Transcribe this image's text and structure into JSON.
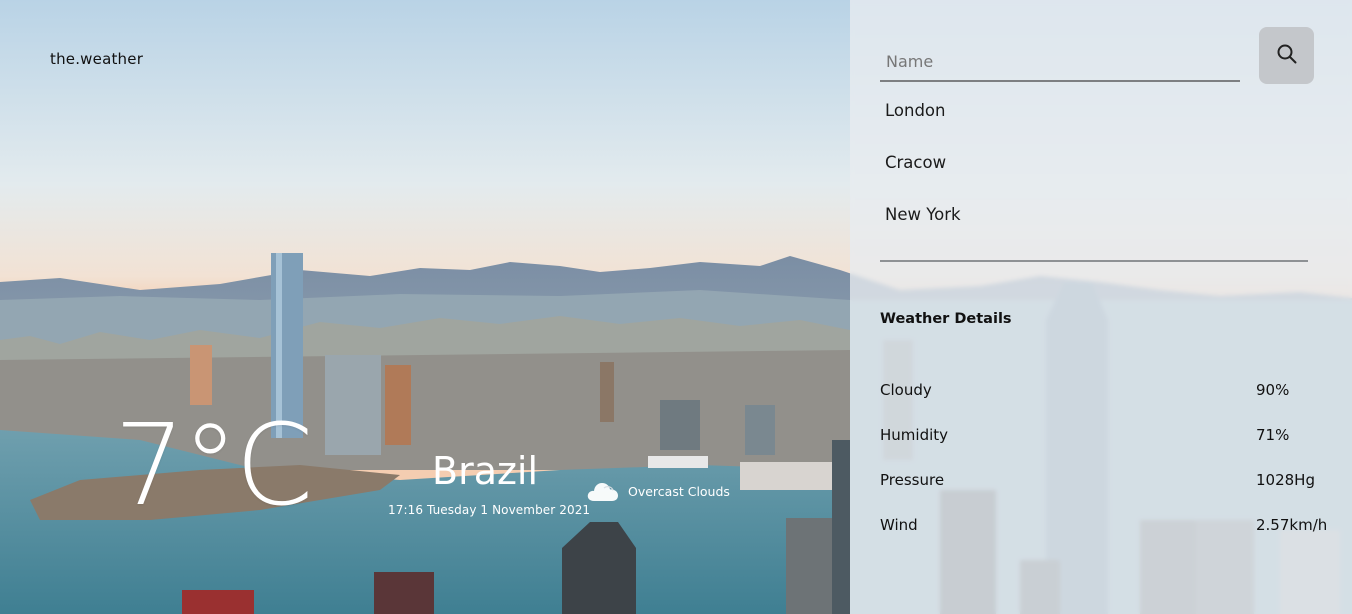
{
  "brand": "the.weather",
  "current": {
    "temperature": "7°C",
    "city": "Brazil",
    "datetime": "17:16 Tuesday 1 November 2021",
    "condition": "Overcast Clouds",
    "condition_icon": "cloud-icon"
  },
  "search": {
    "placeholder": "Name",
    "button_icon": "search-icon"
  },
  "cities": [
    "London",
    "Cracow",
    "New York"
  ],
  "details": {
    "title": "Weather Details",
    "rows": [
      {
        "label": "Cloudy",
        "value": "90%"
      },
      {
        "label": "Humidity",
        "value": "71%"
      },
      {
        "label": "Pressure",
        "value": "1028Hg"
      },
      {
        "label": "Wind",
        "value": "2.57km/h"
      }
    ]
  },
  "colors": {
    "panel_bg": "#e8ecf0",
    "search_button": "#c4c7cb",
    "text_dark": "#111111",
    "text_light": "#ffffff"
  }
}
